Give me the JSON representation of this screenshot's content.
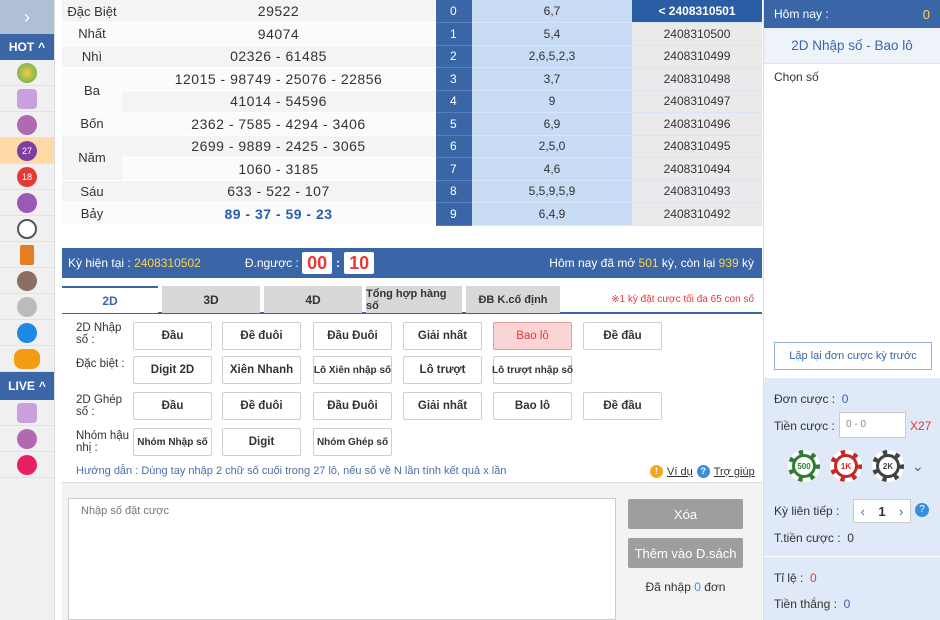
{
  "results": [
    {
      "label": "Đặc Biệt",
      "value": "29522"
    },
    {
      "label": "Nhất",
      "value": "94074"
    },
    {
      "label": "Nhì",
      "value": "02326 - 61485"
    },
    {
      "label": "Ba",
      "value": "12015 - 98749 - 25076 - 22856",
      "value2": "41014 - 54596"
    },
    {
      "label": "Bốn",
      "value": "2362 - 7585 - 4294 - 3406"
    },
    {
      "label": "Năm",
      "value": "2699 - 9889 - 2425 - 3065",
      "value2": "1060 - 3185"
    },
    {
      "label": "Sáu",
      "value": "633 - 522 - 107"
    },
    {
      "label": "Bảy",
      "value": "89 - 37 - 59 - 23"
    }
  ],
  "grid": [
    {
      "i": "0",
      "v": "6,7",
      "p": "< 2408310501"
    },
    {
      "i": "1",
      "v": "5,4",
      "p": "2408310500"
    },
    {
      "i": "2",
      "v": "2,6,5,2,3",
      "p": "2408310499"
    },
    {
      "i": "3",
      "v": "3,7",
      "p": "2408310498"
    },
    {
      "i": "4",
      "v": "9",
      "p": "2408310497"
    },
    {
      "i": "5",
      "v": "6,9",
      "p": "2408310496"
    },
    {
      "i": "6",
      "v": "2,5,0",
      "p": "2408310495"
    },
    {
      "i": "7",
      "v": "4,6",
      "p": "2408310494"
    },
    {
      "i": "8",
      "v": "5,5,9,5,9",
      "p": "2408310493"
    },
    {
      "i": "9",
      "v": "6,4,9",
      "p": "2408310492"
    }
  ],
  "status": {
    "period_label": "Kỳ hiện tại",
    "period": "2408310502",
    "countdown_label": "Đ.ngược :",
    "mm": "00",
    "ss": "10",
    "opened_prefix": "Hôm nay đã mở",
    "opened": "501",
    "opened_mid": "kỳ, còn lại",
    "left": "939",
    "opened_suffix": "kỳ"
  },
  "tabs": [
    "2D",
    "3D",
    "4D",
    "Tổng hợp hàng số",
    "ĐB K.cố định"
  ],
  "tab_note": "※1 kỳ đặt cược tối đa 65 con số",
  "rows": [
    {
      "label": "2D Nhập số :",
      "buttons": [
        "Đầu",
        "Đề đuôi",
        "Đầu Đuôi",
        "Giải nhất",
        "Bao lô",
        "Đề đầu"
      ]
    },
    {
      "label": "Đặc biệt :",
      "buttons": [
        "Digit 2D",
        "Xiên Nhanh",
        "Lô Xiên nhập số",
        "Lô trượt",
        "Lô trượt nhập số"
      ]
    },
    {
      "label": "2D Ghép số :",
      "buttons": [
        "Đầu",
        "Đề đuôi",
        "Đầu Đuôi",
        "Giải nhất",
        "Bao lô",
        "Đề đầu"
      ]
    },
    {
      "label": "Nhóm hậu nhị :",
      "buttons": [
        "Nhóm Nhập số",
        "Digit",
        "Nhóm Ghép số"
      ]
    }
  ],
  "hint": "Hướng dẫn : Dùng tay nhập 2 chữ số cuối trong 27 lô, nếu số về N lần tính kết quả x lần",
  "links": {
    "example": "Ví dụ",
    "help": "Trợ giúp"
  },
  "input": {
    "placeholder": "Nhập số đặt cược",
    "delete": "Xóa",
    "add": "Thêm vào D.sách",
    "count_prefix": "Đã nhập",
    "count": "0",
    "count_suffix": "đơn"
  },
  "right": {
    "today_label": "Hôm nay :",
    "today_value": "0",
    "title": "2D Nhập số - Bao lô",
    "choose": "Chọn số",
    "repeat": "Lặp lại đơn cược kỳ trước",
    "orders_label": "Đơn cược :",
    "orders": "0",
    "money_label": "Tiền cược :",
    "money_placeholder": "0 - 0",
    "mult": "X27",
    "chips": [
      "500",
      "1K",
      "2K"
    ],
    "consecutive_label": "Kỳ liên tiếp :",
    "consecutive": "1",
    "total_label": "T.tiền cược :",
    "total": "0",
    "rate_label": "Tỉ lệ :",
    "rate": "0",
    "win_label": "Tiền thắng :",
    "win": "0"
  },
  "rail": {
    "hot": "HOT",
    "live": "LIVE"
  },
  "colors": {
    "primary": "#3a66a8",
    "accent_red": "#e53935",
    "highlight": "#ffd24a"
  }
}
